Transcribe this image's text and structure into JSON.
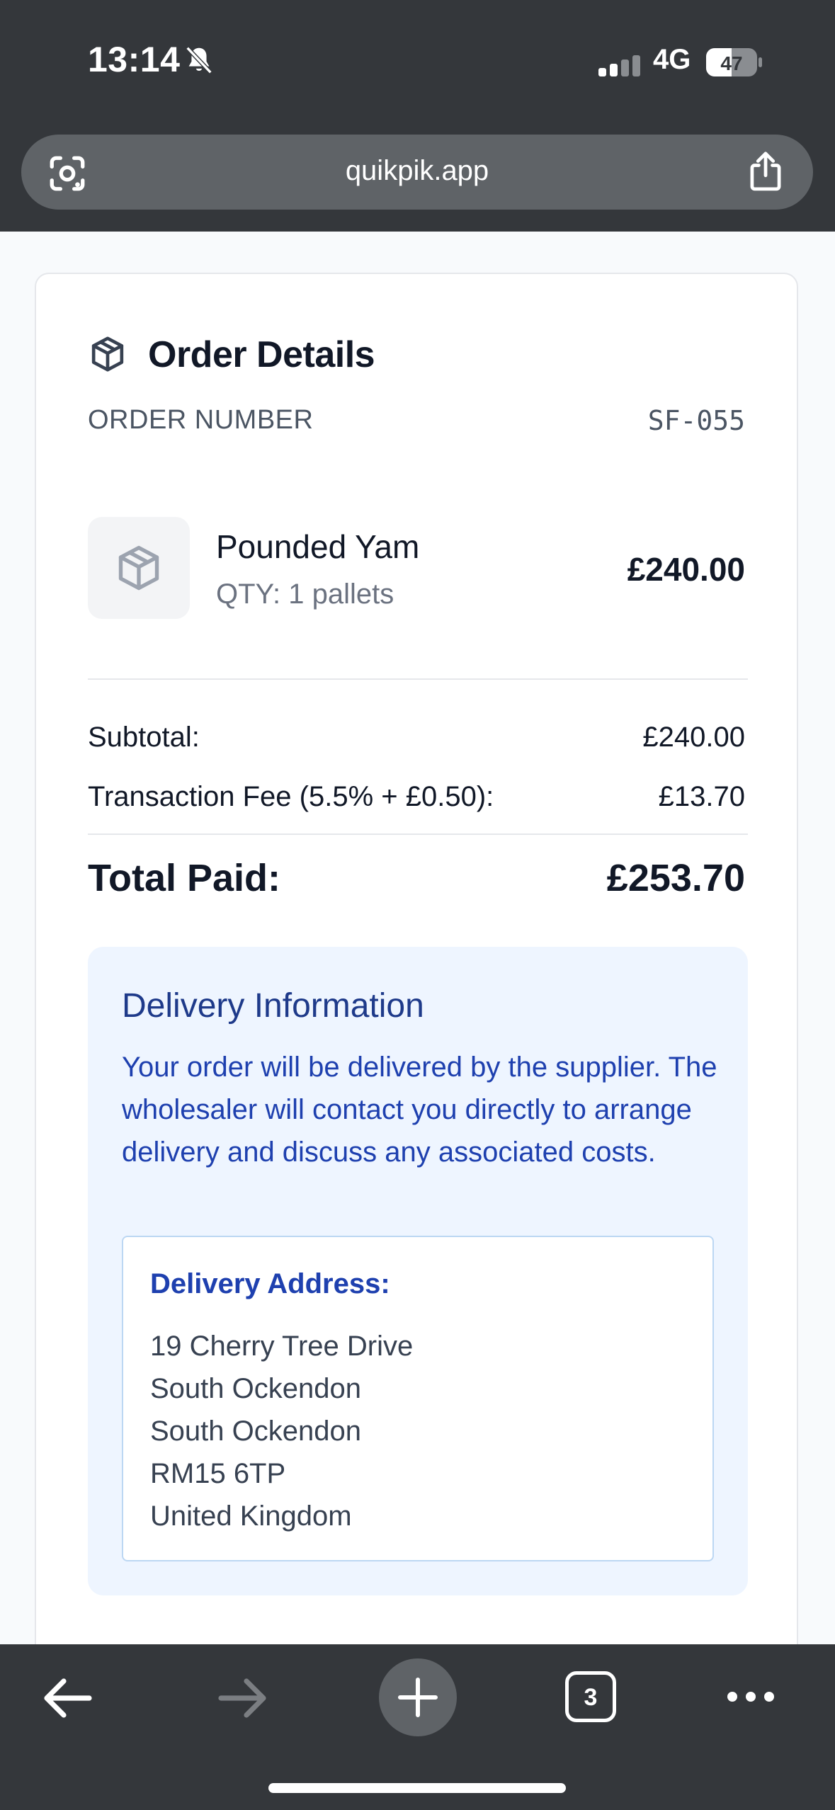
{
  "status_bar": {
    "time": "13:14",
    "network": "4G",
    "battery": "47"
  },
  "browser": {
    "url": "quikpik.app",
    "tabs_count": "3"
  },
  "order": {
    "title": "Order Details",
    "order_number_label": "ORDER NUMBER",
    "order_number": "SF-055",
    "item": {
      "name": "Pounded Yam",
      "qty": "QTY: 1 pallets",
      "price": "£240.00"
    },
    "subtotal_label": "Subtotal:",
    "subtotal": "£240.00",
    "fee_label": "Transaction Fee (5.5% + £0.50):",
    "fee": "£13.70",
    "total_label": "Total Paid:",
    "total": "£253.70"
  },
  "delivery": {
    "title": "Delivery Information",
    "text": "Your order will be delivered by the supplier. The wholesaler will contact you directly to arrange delivery and discuss any associated costs.",
    "address_label": "Delivery Address:",
    "address_lines": [
      "19 Cherry Tree Drive",
      "South Ockendon",
      "South Ockendon",
      "RM15 6TP",
      "United Kingdom"
    ]
  },
  "colors": {
    "chrome": "#34373b",
    "delivery_bg": "#eef5ff",
    "delivery_text": "#1e40af"
  },
  "icons": [
    "bell-slash-icon",
    "signal-icon",
    "battery-icon",
    "camera-lens-icon",
    "share-icon",
    "package-icon",
    "back-arrow-icon",
    "forward-arrow-icon",
    "new-tab-icon",
    "tabs-icon",
    "more-icon"
  ]
}
